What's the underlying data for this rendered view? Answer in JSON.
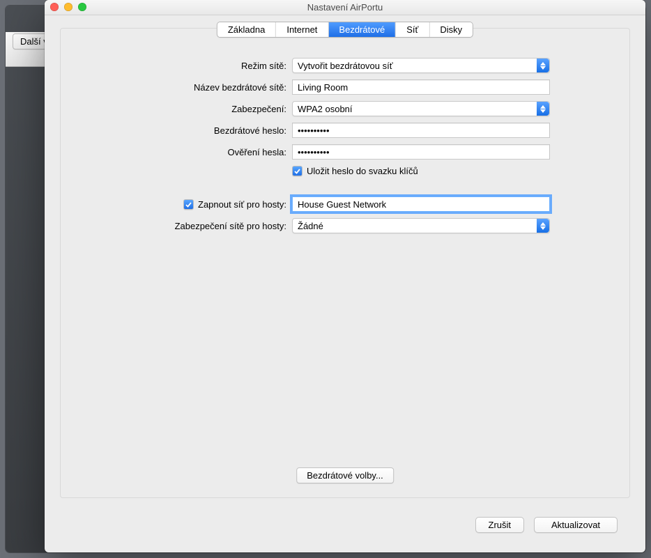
{
  "window_title": "Nastavení AirPortu",
  "back_button": "Další v",
  "tabs": {
    "base": "Základna",
    "internet": "Internet",
    "wireless": "Bezdrátové",
    "network": "Síť",
    "disks": "Disky"
  },
  "labels": {
    "network_mode": "Režim sítě:",
    "wireless_name": "Název bezdrátové sítě:",
    "security": "Zabezpečení:",
    "wireless_password": "Bezdrátové heslo:",
    "verify_password": "Ověření hesla:",
    "enable_guest": "Zapnout síť pro hosty:",
    "guest_security": "Zabezpečení sítě pro hosty:"
  },
  "values": {
    "network_mode": "Vytvořit bezdrátovou síť",
    "wireless_name": "Living Room",
    "security": "WPA2 osobní",
    "wireless_password": "••••••••••",
    "verify_password": "••••••••••",
    "guest_network_name": "House Guest Network",
    "guest_security": "Žádné"
  },
  "checkbox": {
    "remember_label": "Uložit heslo do svazku klíčů",
    "remember_checked": true,
    "guest_checked": true
  },
  "buttons": {
    "wireless_options": "Bezdrátové volby...",
    "cancel": "Zrušit",
    "update": "Aktualizovat"
  }
}
